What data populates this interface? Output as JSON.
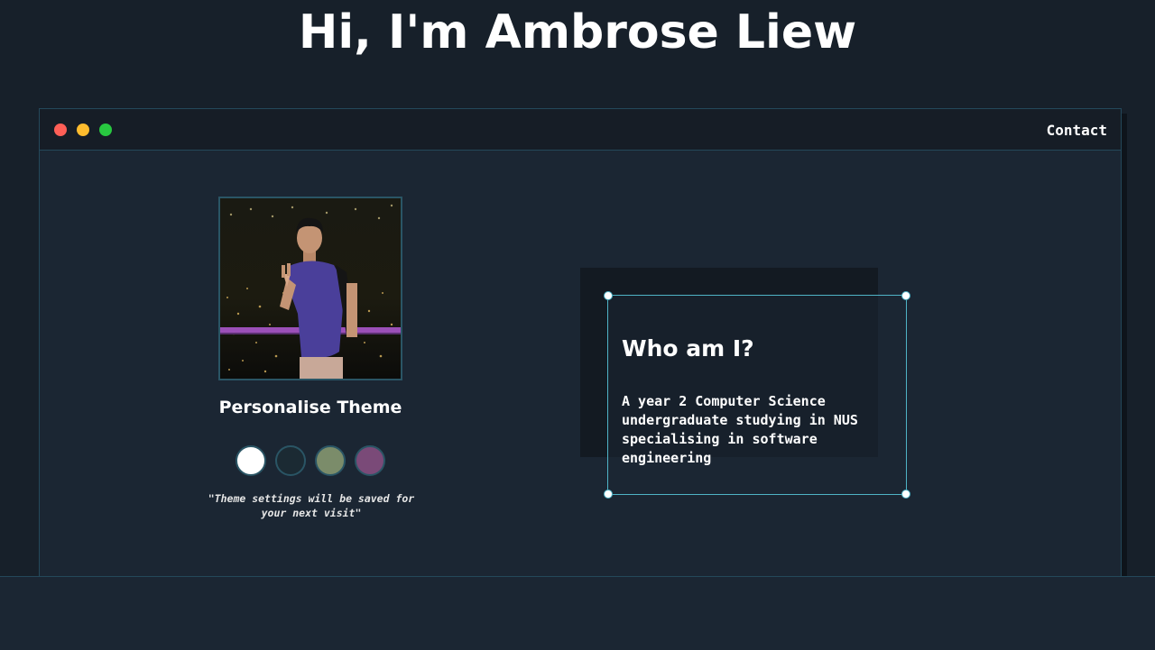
{
  "header": {
    "title": "Hi, I'm Ambrose Liew"
  },
  "window": {
    "controls": [
      {
        "name": "close",
        "color": "#ff5f57"
      },
      {
        "name": "minimize",
        "color": "#febc2e"
      },
      {
        "name": "maximize",
        "color": "#28c840"
      }
    ],
    "nav": {
      "contact_label": "Contact"
    }
  },
  "profile": {
    "photo_icon": "profile-photo"
  },
  "theme": {
    "heading": "Personalise Theme",
    "swatches": [
      {
        "name": "white",
        "color": "#ffffff"
      },
      {
        "name": "dark-teal",
        "color": "#1b2a33"
      },
      {
        "name": "sage",
        "color": "#7b8c6a"
      },
      {
        "name": "mauve",
        "color": "#7a4a78"
      }
    ],
    "note": "\"Theme settings will be saved for your next visit\""
  },
  "about": {
    "title": "Who am I?",
    "text": "A year 2 Computer Science undergraduate studying in NUS specialising in software engineering"
  }
}
